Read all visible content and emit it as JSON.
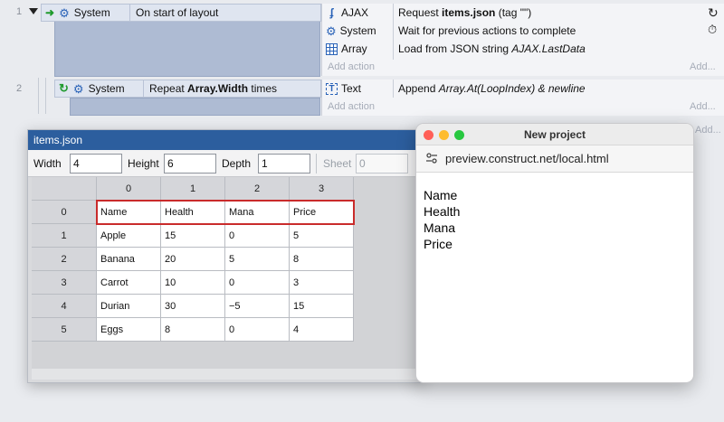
{
  "event1": {
    "number": "1",
    "condition": {
      "object": "System",
      "text": "On start of layout"
    },
    "actions": [
      {
        "object": "AJAX",
        "icon": "ajax-icon",
        "pre": "Request ",
        "bold": "items.json",
        "post": " (tag \"\")",
        "italic": ""
      },
      {
        "object": "System",
        "icon": "gear-icon",
        "pre": "Wait for previous actions to complete",
        "bold": "",
        "post": "",
        "italic": ""
      },
      {
        "object": "Array",
        "icon": "array-grid-icon",
        "pre": "Load from JSON string ",
        "bold": "",
        "post": "",
        "italic": "AJAX.LastData"
      }
    ],
    "add_action": "Add action",
    "add": "Add..."
  },
  "event2": {
    "number": "2",
    "condition": {
      "object": "System",
      "pre": "Repeat ",
      "bold": "Array.Width",
      "post": " times"
    },
    "actions": [
      {
        "object": "Text",
        "icon": "text-object-icon",
        "pre": "Append ",
        "italic": "Array.At(LoopIndex) & newline"
      }
    ],
    "add_action": "Add action",
    "add": "Add...",
    "add_partial": "Add..."
  },
  "array_editor": {
    "title": "items.json",
    "width_label": "Width",
    "width_value": "4",
    "height_label": "Height",
    "height_value": "6",
    "depth_label": "Depth",
    "depth_value": "1",
    "sheet_label": "Sheet",
    "sheet_value": "0",
    "column_headers": [
      "0",
      "1",
      "2",
      "3"
    ],
    "row_headers": [
      "0",
      "1",
      "2",
      "3",
      "4",
      "5"
    ],
    "rows": [
      [
        "Name",
        "Health",
        "Mana",
        "Price"
      ],
      [
        "Apple",
        "15",
        "0",
        "5"
      ],
      [
        "Banana",
        "20",
        "5",
        "8"
      ],
      [
        "Carrot",
        "10",
        "0",
        "3"
      ],
      [
        "Durian",
        "30",
        "−5",
        "15"
      ],
      [
        "Eggs",
        "8",
        "0",
        "4"
      ]
    ]
  },
  "browser": {
    "title": "New project",
    "url": "preview.construct.net/local.html",
    "lines": [
      "Name",
      "Health",
      "Mana",
      "Price"
    ]
  }
}
